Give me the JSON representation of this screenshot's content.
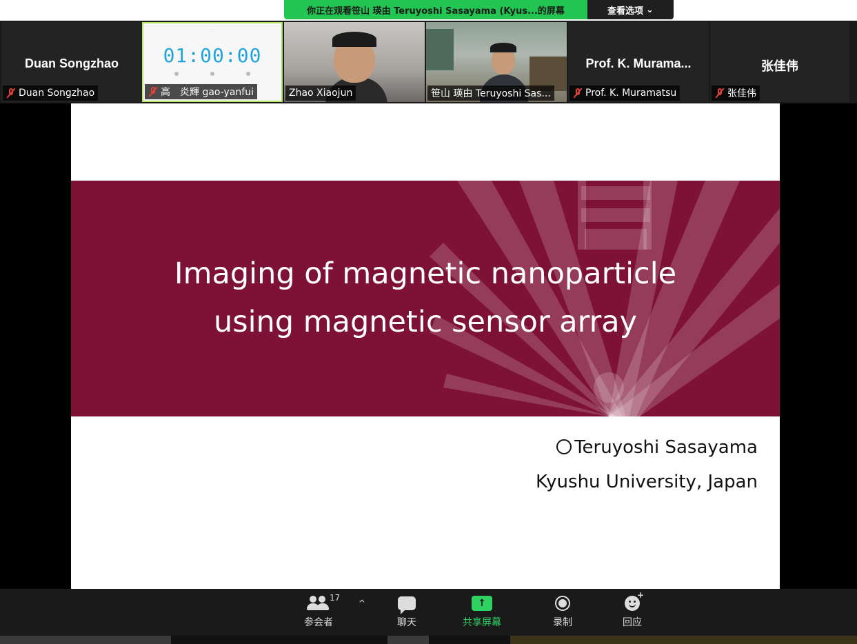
{
  "banner": {
    "message": "你正在观看笹山 瑛由 Teruyoshi Sasayama (Kyus...的屏幕",
    "options_label": "查看选项",
    "options_caret": "⌄"
  },
  "gallery": {
    "tiles": [
      {
        "display_name": "Duan Songzhao",
        "tag": "Duan Songzhao",
        "muted": true
      },
      {
        "display_name": "",
        "tag": "高　炎輝 gao-yanfui",
        "muted": true,
        "timer": "01:00:00"
      },
      {
        "display_name": "",
        "tag": "Zhao Xiaojun",
        "muted": false
      },
      {
        "display_name": "",
        "tag": "笹山 瑛由 Teruyoshi Sas...",
        "muted": false
      },
      {
        "display_name": "Prof. K. Murama...",
        "tag": "Prof. K. Muramatsu",
        "muted": true
      },
      {
        "display_name": "张佳伟",
        "tag": "张佳伟",
        "muted": true
      }
    ]
  },
  "slide": {
    "title_line1": "Imaging of magnetic nanoparticle",
    "title_line2": "using magnetic sensor array",
    "author": "Teruyoshi Sasayama",
    "affiliation": "Kyushu University, Japan",
    "band_color": "#7e1236"
  },
  "toolbar": {
    "participants_label": "参会者",
    "participants_count": "17",
    "caret": "^",
    "chat_label": "聊天",
    "share_label": "共享屏幕",
    "share_arrow": "↑",
    "record_label": "录制",
    "reactions_label": "回应",
    "reactions_plus": "+",
    "accent_color": "#2ed162"
  }
}
